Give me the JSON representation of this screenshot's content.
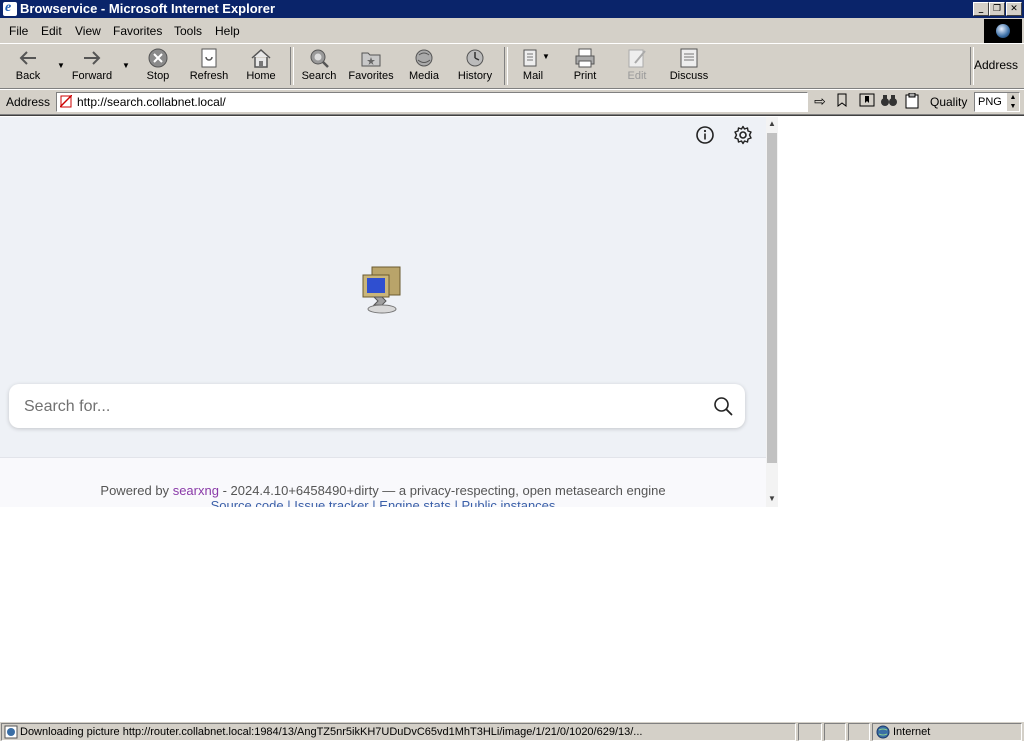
{
  "window": {
    "title": "Browservice - Microsoft Internet Explorer",
    "controls": [
      "minimize",
      "restore",
      "close"
    ]
  },
  "menu": [
    {
      "label": "File"
    },
    {
      "label": "Edit"
    },
    {
      "label": "View"
    },
    {
      "label": "Favorites"
    },
    {
      "label": "Tools"
    },
    {
      "label": "Help"
    }
  ],
  "toolbar": {
    "back": "Back",
    "forward": "Forward",
    "stop": "Stop",
    "refresh": "Refresh",
    "home": "Home",
    "search": "Search",
    "favorites": "Favorites",
    "media": "Media",
    "history": "History",
    "mail": "Mail",
    "print": "Print",
    "edit": "Edit",
    "discuss": "Discuss",
    "address_right": "Address"
  },
  "addressbar": {
    "label": "Address",
    "url": "http://search.collabnet.local/",
    "quality_label": "Quality",
    "quality_value": "PNG"
  },
  "page": {
    "search_placeholder": "Search for...",
    "footer_prefix": "Powered by",
    "footer_link": "searxng",
    "footer_suffix": "- 2024.4.10+6458490+dirty — a privacy-respecting, open metasearch engine",
    "footer_links": [
      "Source code",
      "Issue tracker",
      "Engine stats",
      "Public instances"
    ],
    "footer_sep": "|"
  },
  "status": {
    "text": "Downloading picture http://router.collabnet.local:1984/13/AngTZ5nr5ikKH7UDuDvC65vd1MhT3HLi/image/1/21/0/1020/629/13/...",
    "zone": "Internet"
  }
}
